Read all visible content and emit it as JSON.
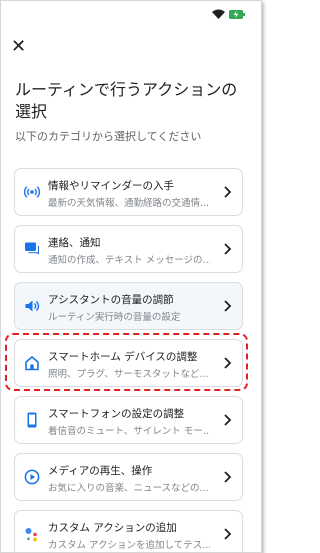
{
  "header": {
    "close_icon": "close-icon",
    "title": "ルーティンで行うアクションの選択",
    "subtitle": "以下のカテゴリから選択してください"
  },
  "status_bar": {
    "wifi_icon": "wifi-icon",
    "battery_icon": "battery-charging-icon",
    "battery_color": "#34a853"
  },
  "categories": [
    {
      "label": "情報やリマインダーの入手",
      "desc": "最新の天気情報、通勤経路の交通情...",
      "icon": "broadcast-icon"
    },
    {
      "label": "連絡、通知",
      "desc": "通知の作成、テキスト メッセージの...",
      "icon": "message-icon"
    },
    {
      "label": "アシスタントの音量の調節",
      "desc": "ルーティン実行時の音量の設定",
      "icon": "speaker-icon"
    },
    {
      "label": "スマートホーム デバイスの調整",
      "desc": "照明、プラグ、サーモスタットなど...",
      "icon": "home-icon"
    },
    {
      "label": "スマートフォンの設定の調整",
      "desc": "着信音のミュート、サイレント モー...",
      "icon": "phone-icon"
    },
    {
      "label": "メディアの再生、操作",
      "desc": "お気に入りの音楽、ニュースなどの...",
      "icon": "play-icon"
    },
    {
      "label": "カスタム アクションの追加",
      "desc": "カスタム アクションを追加してテス...",
      "icon": "assistant-icon"
    }
  ],
  "colors": {
    "accent": "#1a73e8",
    "highlight": "#e02020"
  }
}
